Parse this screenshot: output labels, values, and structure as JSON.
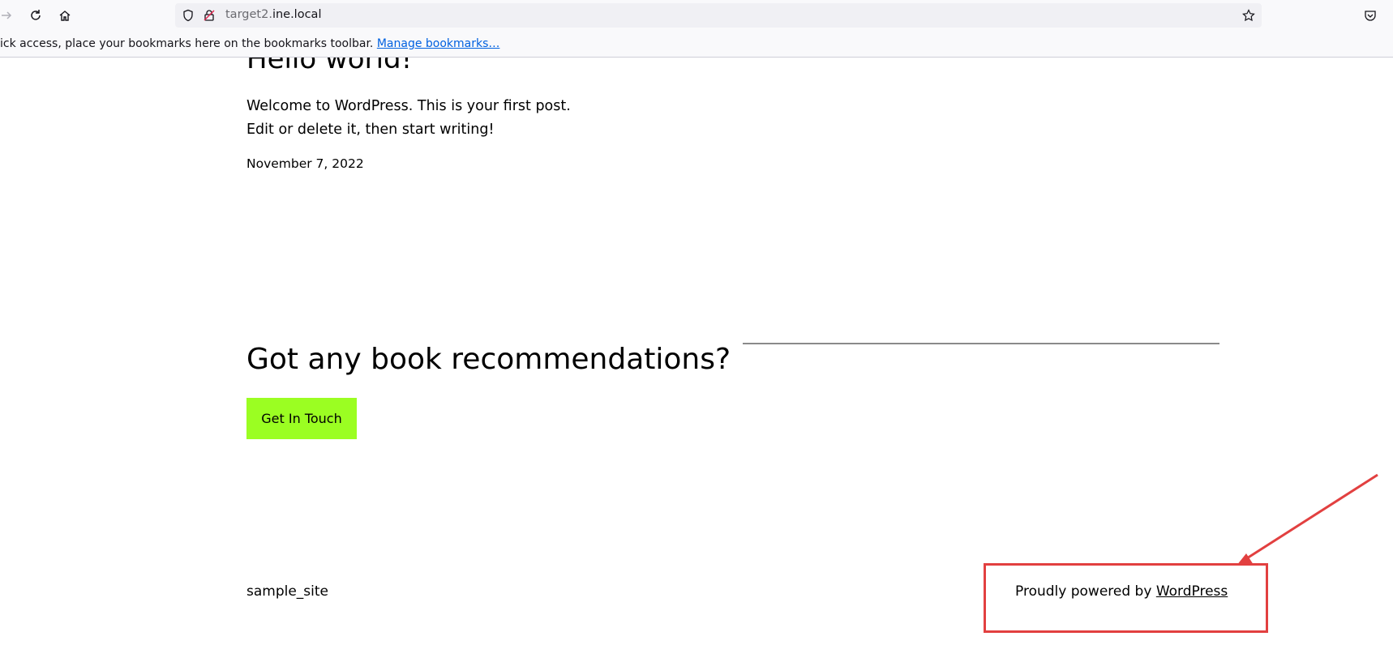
{
  "browser": {
    "url_subdomain": "target2.",
    "url_domain": "ine.local",
    "bookmarks_message": "ick access, place your bookmarks here on the bookmarks toolbar. ",
    "manage_bookmarks_link": "Manage bookmarks…",
    "icons": [
      "forward-icon",
      "reload-icon",
      "home-icon",
      "shield-icon",
      "insecure-lock-icon",
      "bookmark-star-icon",
      "pocket-icon"
    ]
  },
  "post": {
    "title": "Hello world!",
    "excerpt": "Welcome to WordPress. This is your first post. Edit or delete it, then start writing!",
    "date": "November 7, 2022"
  },
  "cta": {
    "heading": "Got any book recommendations?",
    "button_label": "Get In Touch",
    "button_color": "#9bfe22"
  },
  "footer": {
    "site_name": "sample_site",
    "powered_prefix": "Proudly powered by ",
    "powered_link": "WordPress"
  },
  "annotation": {
    "color": "#e24040"
  }
}
